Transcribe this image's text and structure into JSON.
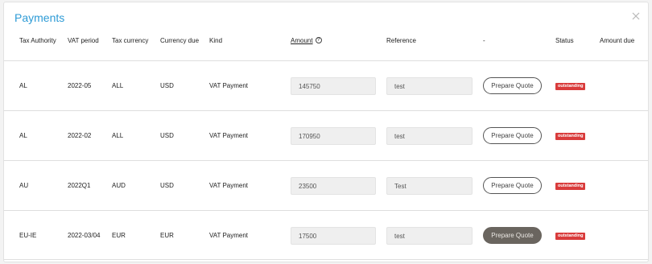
{
  "modal": {
    "title": "Payments",
    "close_icon": "close-icon"
  },
  "columns": {
    "tax_authority": "Tax Authority",
    "vat_period": "VAT period",
    "tax_currency": "Tax currency",
    "currency_due": "Currency due",
    "kind": "Kind",
    "amount": "Amount",
    "amount_info_icon": "question-circle-icon",
    "reference": "Reference",
    "action": "-",
    "status": "Status",
    "amount_due": "Amount due"
  },
  "rows": [
    {
      "tax_authority": "AL",
      "vat_period": "2022-05",
      "tax_currency": "ALL",
      "currency_due": "USD",
      "kind": "VAT Payment",
      "amount": "145750",
      "reference": "test",
      "action_label": "Prepare Quote",
      "status": "outstanding",
      "amount_due": ""
    },
    {
      "tax_authority": "AL",
      "vat_period": "2022-02",
      "tax_currency": "ALL",
      "currency_due": "USD",
      "kind": "VAT Payment",
      "amount": "170950",
      "reference": "test",
      "action_label": "Prepare Quote",
      "status": "outstanding",
      "amount_due": ""
    },
    {
      "tax_authority": "AU",
      "vat_period": "2022Q1",
      "tax_currency": "AUD",
      "currency_due": "USD",
      "kind": "VAT Payment",
      "amount": "23500",
      "reference": "Test",
      "action_label": "Prepare Quote",
      "status": "outstanding",
      "amount_due": ""
    },
    {
      "tax_authority": "EU-IE",
      "vat_period": "2022-03/04",
      "tax_currency": "EUR",
      "currency_due": "EUR",
      "kind": "VAT Payment",
      "amount": "17500",
      "reference": "test",
      "action_label": "Prepare Quote",
      "status": "outstanding",
      "amount_due": ""
    }
  ],
  "colors": {
    "title": "#2e9bd6",
    "status_badge": "#d93b3b",
    "button_active_bg": "#6a655f"
  }
}
